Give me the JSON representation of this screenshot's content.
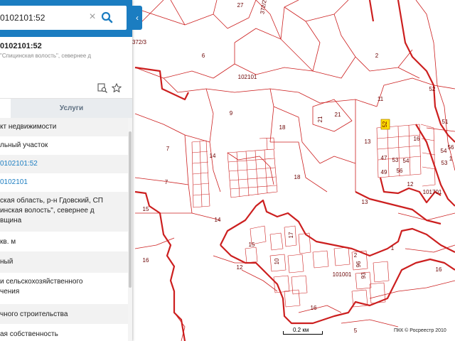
{
  "search": {
    "query": "0102101:52"
  },
  "object": {
    "title": "0102101:52",
    "address_preview": "\"Спицинская волость\", севернее д",
    "tabs": {
      "services": "Услуги"
    },
    "rows": [
      {
        "text": "кт недвижимости"
      },
      {
        "text": "льный участок"
      },
      {
        "text": "0102101:52",
        "link": true
      },
      {
        "text": "0102101",
        "link": true
      },
      {
        "lines": [
          "ская область, р-н Гдовский, СП",
          "инская волость\", севернее д",
          "вщина"
        ]
      },
      {
        "text": "кв. м"
      },
      {
        "text": "ный"
      },
      {
        "lines": [
          "и сельскохозяйственного",
          "чения"
        ]
      },
      {
        "text": "чного строительства"
      },
      {
        "text": "ая собственность"
      }
    ]
  },
  "map": {
    "quarter_labels": [
      "102101",
      "101001",
      "101701"
    ],
    "plot_labels": [
      "27",
      "372/2",
      "372/3",
      "6",
      "2",
      "102101",
      "9",
      "11",
      "52",
      "51",
      "18",
      "21",
      "21",
      "13",
      "52",
      "47",
      "53",
      "54",
      "49",
      "56",
      "7",
      "14",
      "18",
      "12",
      "7",
      "13",
      "101701",
      "15",
      "14",
      "12",
      "101001",
      "17",
      "10",
      "15",
      "16",
      "2",
      "96",
      "93",
      "1",
      "16",
      "16",
      "5",
      "53",
      "54",
      "56",
      "1",
      "16"
    ],
    "scale_label": "0.2 км",
    "attribution": "ПКК © Росреестр 2010",
    "line_color": "#cc1f1f",
    "highlight_color": "#ffe000"
  },
  "icons": {
    "clear": "close-icon",
    "search": "search-icon",
    "collapse": "chevron-left-icon",
    "map_link": "map-search-icon",
    "favorite": "star-icon"
  }
}
